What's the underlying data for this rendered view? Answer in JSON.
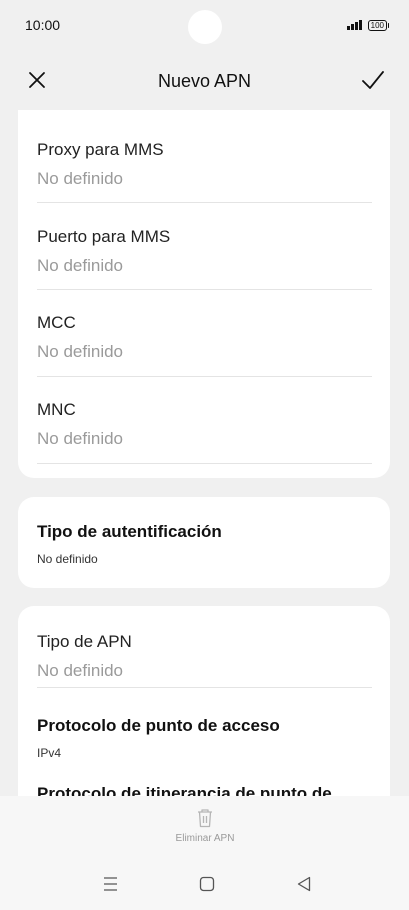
{
  "status_bar": {
    "time": "10:00",
    "battery": "100"
  },
  "header": {
    "title": "Nuevo APN",
    "close_icon": "close-icon",
    "confirm_icon": "check-icon"
  },
  "fields": [
    {
      "label": "Proxy para MMS",
      "value": "No definido"
    },
    {
      "label": "Puerto para MMS",
      "value": "No definido"
    },
    {
      "label": "MCC",
      "value": "No definido"
    },
    {
      "label": "MNC",
      "value": "No definido"
    }
  ],
  "auth": {
    "label": "Tipo de autentificación",
    "value": "No definido"
  },
  "apn_type": {
    "label": "Tipo de APN",
    "value": "No definido"
  },
  "protocol": {
    "label": "Protocolo de punto de acceso",
    "value": "IPv4"
  },
  "roaming_protocol": {
    "label": "Protocolo de itinerancia de punto de acceso"
  },
  "bottom": {
    "delete_label": "Eliminar APN",
    "delete_icon": "trash-icon"
  },
  "nav": {
    "menu_icon": "menu-icon",
    "home_icon": "home-icon",
    "back_icon": "back-icon"
  }
}
